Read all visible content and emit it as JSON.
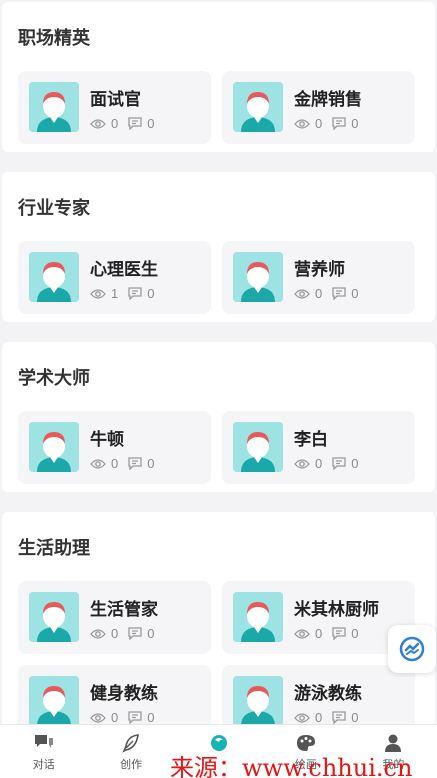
{
  "sections": [
    {
      "title": "职场精英",
      "cards": [
        {
          "name": "面试官",
          "views": "0",
          "comments": "0"
        },
        {
          "name": "金牌销售",
          "views": "0",
          "comments": "0"
        }
      ]
    },
    {
      "title": "行业专家",
      "cards": [
        {
          "name": "心理医生",
          "views": "1",
          "comments": "0"
        },
        {
          "name": "营养师",
          "views": "0",
          "comments": "0"
        }
      ]
    },
    {
      "title": "学术大师",
      "cards": [
        {
          "name": "牛顿",
          "views": "0",
          "comments": "0"
        },
        {
          "name": "李白",
          "views": "0",
          "comments": "0"
        }
      ]
    },
    {
      "title": "生活助理",
      "cards": [
        {
          "name": "生活管家",
          "views": "0",
          "comments": "0"
        },
        {
          "name": "米其林厨师",
          "views": "0",
          "comments": "0"
        },
        {
          "name": "健身教练",
          "views": "0",
          "comments": "0"
        },
        {
          "name": "游泳教练",
          "views": "0",
          "comments": "0"
        }
      ]
    }
  ],
  "tabbar": {
    "tabs": [
      {
        "label": "对话",
        "icon": "chat-icon"
      },
      {
        "label": "创作",
        "icon": "feather-icon"
      },
      {
        "label": "",
        "icon": "agent-icon"
      },
      {
        "label": "绘画",
        "icon": "palette-icon"
      },
      {
        "label": "我的",
        "icon": "user-icon"
      }
    ],
    "active_color": "#17b3b3"
  },
  "watermark": "来源：www.chhui.cn",
  "colors": {
    "avatar_bg": "#9ee3e3",
    "avatar_hair": "#e85a5a",
    "card_bg": "#f5f5f7"
  }
}
